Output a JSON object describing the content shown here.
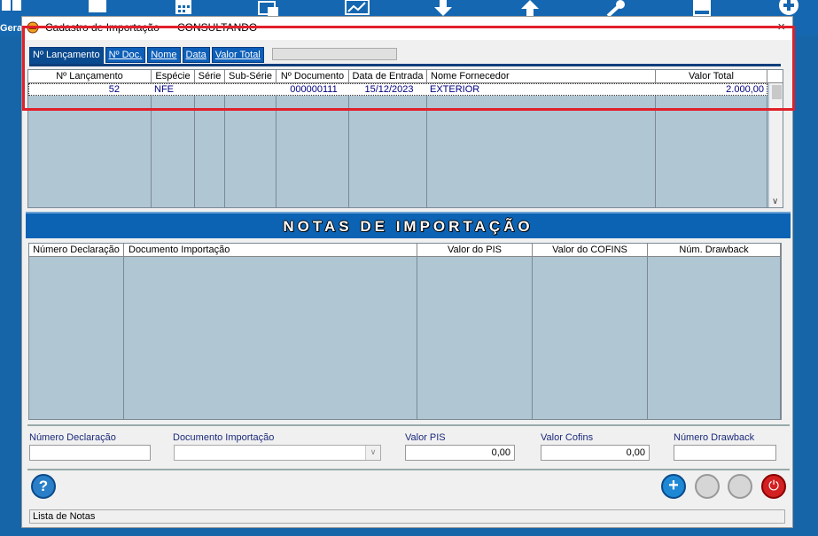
{
  "toolbar": {
    "label": "Gera"
  },
  "window": {
    "title": "Cadastro de Importação",
    "status": "CONSULTANDO",
    "close_label": "×"
  },
  "tabs": [
    {
      "label": "Nº Lançamento"
    },
    {
      "label": "Nº Doc."
    },
    {
      "label": "Nome"
    },
    {
      "label": "Data"
    },
    {
      "label": "Valor Total"
    }
  ],
  "top_grid": {
    "headers": [
      "Nº Lançamento",
      "Espécie",
      "Série",
      "Sub-Série",
      "Nº Documento",
      "Data de Entrada",
      "Nome Fornecedor",
      "Valor Total"
    ],
    "rows": [
      {
        "lancamento": "52",
        "especie": "NFE",
        "serie": "",
        "sub_serie": "",
        "documento": "000000111",
        "data_entrada": "15/12/2023",
        "fornecedor": "EXTERIOR",
        "valor_total": "2.000,00"
      }
    ]
  },
  "section": {
    "title": "NOTAS DE IMPORTAÇÃO"
  },
  "bottom_grid": {
    "headers": [
      "Número Declaração",
      "Documento Importação",
      "Valor do PIS",
      "Valor do COFINS",
      "Núm. Drawback"
    ]
  },
  "fields": {
    "numero_declaracao_label": "Número Declaração",
    "numero_declaracao_value": "",
    "documento_importacao_label": "Documento Importação",
    "documento_importacao_value": "",
    "valor_pis_label": "Valor PIS",
    "valor_pis_value": "0,00",
    "valor_cofins_label": "Valor Cofins",
    "valor_cofins_value": "0,00",
    "numero_drawback_label": "Número Drawback",
    "numero_drawback_value": ""
  },
  "buttons": {
    "help_label": "?",
    "add_label": "+",
    "power_label": "⏻"
  },
  "statusbar": {
    "text": "Lista de Notas"
  }
}
